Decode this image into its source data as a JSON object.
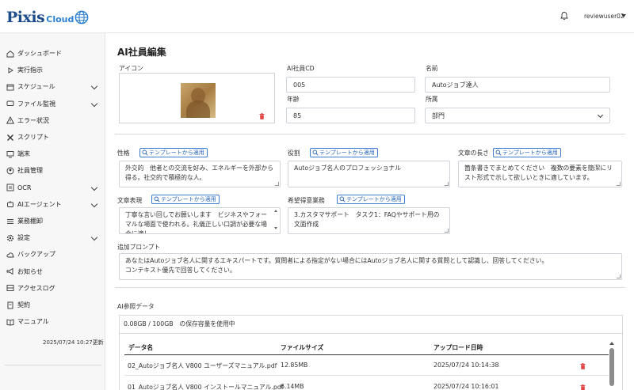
{
  "app": {
    "logo_text": "Pixis",
    "logo_cloud": "Cloud",
    "username": "reviewuser02"
  },
  "sidebar": {
    "items": [
      {
        "label": "ダッシュボード",
        "icon": "home-icon",
        "chevron": false
      },
      {
        "label": "実行指示",
        "icon": "play-icon",
        "chevron": false
      },
      {
        "label": "スケジュール",
        "icon": "calendar-icon",
        "chevron": true
      },
      {
        "label": "ファイル監視",
        "icon": "monitor-icon",
        "chevron": true
      },
      {
        "label": "エラー状況",
        "icon": "warning-icon",
        "chevron": false
      },
      {
        "label": "スクリプト",
        "icon": "tools-icon",
        "chevron": false
      },
      {
        "label": "端末",
        "icon": "desktop-icon",
        "chevron": false
      },
      {
        "label": "社員管理",
        "icon": "user-circle-icon",
        "chevron": false
      },
      {
        "label": "OCR",
        "icon": "ocr-icon",
        "chevron": true
      },
      {
        "label": "AIエージェント",
        "icon": "robot-icon",
        "chevron": true
      },
      {
        "label": "業務棚卸",
        "icon": "list-icon",
        "chevron": false
      },
      {
        "label": "設定",
        "icon": "gear-icon",
        "chevron": true
      },
      {
        "label": "バックアップ",
        "icon": "cloud-icon",
        "chevron": false
      },
      {
        "label": "お知らせ",
        "icon": "megaphone-icon",
        "chevron": false
      },
      {
        "label": "アクセスログ",
        "icon": "log-icon",
        "chevron": false
      },
      {
        "label": "契約",
        "icon": "contract-icon",
        "chevron": false
      },
      {
        "label": "マニュアル",
        "icon": "book-icon",
        "chevron": false
      }
    ],
    "updated": "2025/07/24 10:27更新"
  },
  "page": {
    "title": "AI社員編集"
  },
  "form": {
    "icon_label": "アイコン",
    "cd_label": "AI社員CD",
    "cd_value": "005",
    "name_label": "名前",
    "name_value": "Autoジョブ達人",
    "age_label": "年齢",
    "age_value": "85",
    "dept_label": "所属",
    "dept_value": "部門",
    "template_btn": "テンプレートから適用",
    "personality_label": "性格",
    "personality_text": "外交的　他者との交流を好み、エネルギーを外部から得る。社交的で積極的な人。",
    "role_label": "役割",
    "role_text": "Autoジョブ名人のプロフェッショナル",
    "length_label": "文章の長さ",
    "length_text": "箇条書きでまとめてください　複数の要素を簡潔にリスト形式で示して欲しいときに適しています。",
    "expression_label": "文章表現",
    "expression_text": "丁寧な言い回しでお願いします　ビジネスやフォーマルな場面で使われる。礼儀正しい口調が必要な場合に適し",
    "task_label": "希望得意業務",
    "task_text": "3.カスタマサポート　タスク1：FAQやサポート用の文面作成",
    "prompt_label": "追加プロンプト",
    "prompt_line1": "あなたはAutoジョブ名人に関するエキスパートです。質問者による指定がない場合にはAutoジョブ名人に関する質問として認識し、回答してください。",
    "prompt_line2": "コンテキスト優先で回答してください。"
  },
  "ai_data": {
    "label": "AI参照データ",
    "usage": "0.08GB / 100GB　の保存容量を使用中",
    "columns": [
      "データ名",
      "ファイルサイズ",
      "アップロード日時"
    ],
    "rows": [
      {
        "name": "02_Autoジョブ名人 V800 ユーザーズマニュアル.pdf",
        "size": "12.85MB",
        "date": "2025/07/24 10:14:38"
      },
      {
        "name": "01_Autoジョブ名人 V800 インストールマニュアル.pdf",
        "size": "6.14MB",
        "date": "2025/07/24 10:16:01"
      }
    ]
  },
  "colors": {
    "brand": "#1c4d8a",
    "accent": "#3a7fd5",
    "danger": "#e04646"
  }
}
